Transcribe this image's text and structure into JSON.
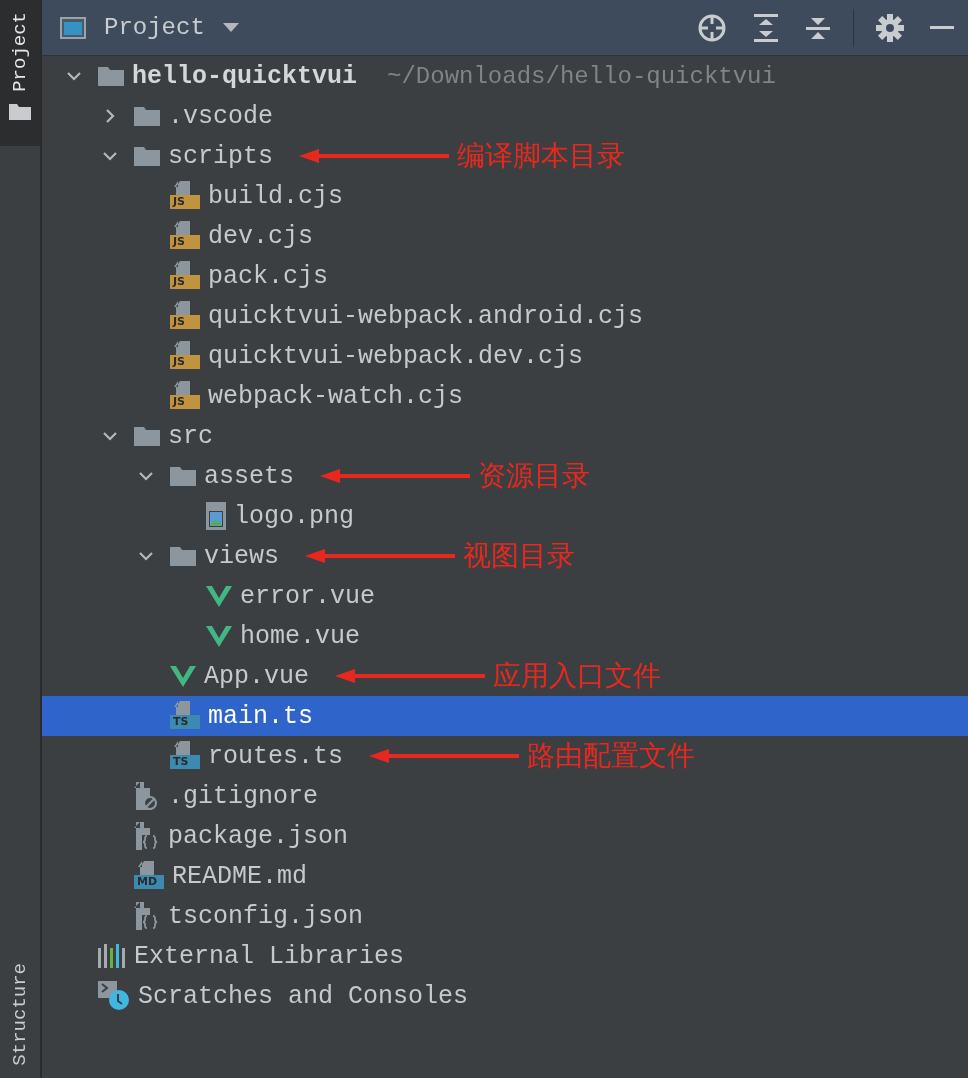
{
  "side_tabs": [
    {
      "label": "Project",
      "selected": true
    },
    {
      "label": "Structure",
      "selected": false
    }
  ],
  "header": {
    "title": "Project"
  },
  "tree": [
    {
      "kind": "folder",
      "name": "hello-quicktvui",
      "path": "~/Downloads/hello-quicktvui",
      "expanded": true,
      "selected": false,
      "children": [
        {
          "kind": "folder",
          "name": ".vscode",
          "expanded": false,
          "selected": false
        },
        {
          "kind": "folder",
          "name": "scripts",
          "expanded": true,
          "selected": false,
          "annotation": "编译脚本目录",
          "children": [
            {
              "kind": "js",
              "badge": "JS",
              "name": "build.cjs",
              "selected": false
            },
            {
              "kind": "js",
              "badge": "JS",
              "name": "dev.cjs",
              "selected": false
            },
            {
              "kind": "js",
              "badge": "JS",
              "name": "pack.cjs",
              "selected": false
            },
            {
              "kind": "js",
              "badge": "JS",
              "name": "quicktvui-webpack.android.cjs",
              "selected": false
            },
            {
              "kind": "js",
              "badge": "JS",
              "name": "quicktvui-webpack.dev.cjs",
              "selected": false
            },
            {
              "kind": "js",
              "badge": "JS",
              "name": "webpack-watch.cjs",
              "selected": false
            }
          ]
        },
        {
          "kind": "folder",
          "name": "src",
          "expanded": true,
          "selected": false,
          "children": [
            {
              "kind": "folder",
              "name": "assets",
              "expanded": true,
              "selected": false,
              "annotation": "资源目录",
              "children": [
                {
                  "kind": "image",
                  "name": "logo.png",
                  "selected": false
                }
              ]
            },
            {
              "kind": "folder",
              "name": "views",
              "expanded": true,
              "selected": false,
              "annotation": "视图目录",
              "children": [
                {
                  "kind": "vue",
                  "name": "error.vue",
                  "selected": false
                },
                {
                  "kind": "vue",
                  "name": "home.vue",
                  "selected": false
                }
              ]
            },
            {
              "kind": "vue",
              "name": "App.vue",
              "selected": false,
              "annotation": "应用入口文件"
            },
            {
              "kind": "ts",
              "badge": "TS",
              "name": "main.ts",
              "selected": true
            },
            {
              "kind": "ts",
              "badge": "TS",
              "name": "routes.ts",
              "selected": false,
              "annotation": "路由配置文件"
            }
          ]
        },
        {
          "kind": "ignore",
          "name": ".gitignore",
          "selected": false
        },
        {
          "kind": "json",
          "name": "package.json",
          "selected": false
        },
        {
          "kind": "md",
          "badge": "MD",
          "name": "README.md",
          "selected": false
        },
        {
          "kind": "json",
          "name": "tsconfig.json",
          "selected": false
        }
      ]
    },
    {
      "kind": "libraries",
      "name": "External Libraries",
      "selected": false
    },
    {
      "kind": "scratches",
      "name": "Scratches and Consoles",
      "selected": false
    }
  ]
}
